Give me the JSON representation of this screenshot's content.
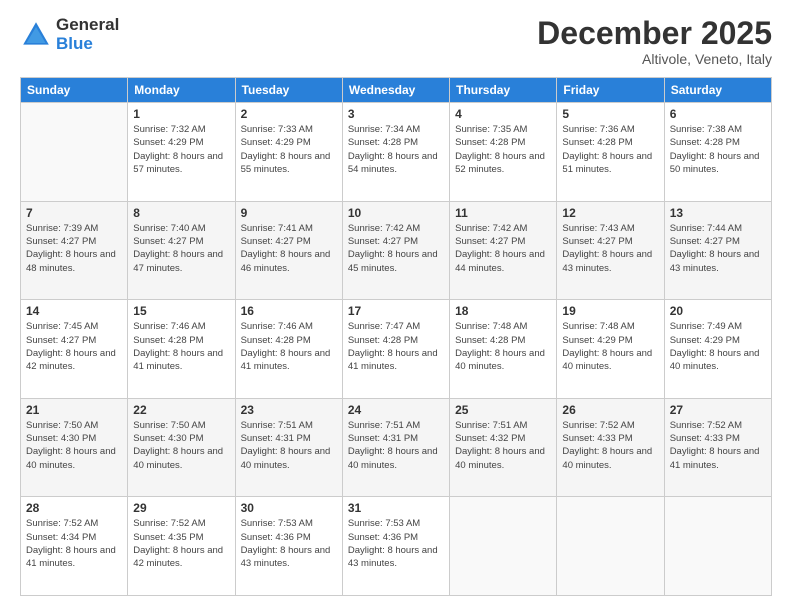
{
  "logo": {
    "general": "General",
    "blue": "Blue"
  },
  "header": {
    "month": "December 2025",
    "location": "Altivole, Veneto, Italy"
  },
  "days_of_week": [
    "Sunday",
    "Monday",
    "Tuesday",
    "Wednesday",
    "Thursday",
    "Friday",
    "Saturday"
  ],
  "weeks": [
    [
      {
        "day": "",
        "sunrise": "",
        "sunset": "",
        "daylight": "",
        "empty": true
      },
      {
        "day": "1",
        "sunrise": "Sunrise: 7:32 AM",
        "sunset": "Sunset: 4:29 PM",
        "daylight": "Daylight: 8 hours and 57 minutes."
      },
      {
        "day": "2",
        "sunrise": "Sunrise: 7:33 AM",
        "sunset": "Sunset: 4:29 PM",
        "daylight": "Daylight: 8 hours and 55 minutes."
      },
      {
        "day": "3",
        "sunrise": "Sunrise: 7:34 AM",
        "sunset": "Sunset: 4:28 PM",
        "daylight": "Daylight: 8 hours and 54 minutes."
      },
      {
        "day": "4",
        "sunrise": "Sunrise: 7:35 AM",
        "sunset": "Sunset: 4:28 PM",
        "daylight": "Daylight: 8 hours and 52 minutes."
      },
      {
        "day": "5",
        "sunrise": "Sunrise: 7:36 AM",
        "sunset": "Sunset: 4:28 PM",
        "daylight": "Daylight: 8 hours and 51 minutes."
      },
      {
        "day": "6",
        "sunrise": "Sunrise: 7:38 AM",
        "sunset": "Sunset: 4:28 PM",
        "daylight": "Daylight: 8 hours and 50 minutes."
      }
    ],
    [
      {
        "day": "7",
        "sunrise": "Sunrise: 7:39 AM",
        "sunset": "Sunset: 4:27 PM",
        "daylight": "Daylight: 8 hours and 48 minutes."
      },
      {
        "day": "8",
        "sunrise": "Sunrise: 7:40 AM",
        "sunset": "Sunset: 4:27 PM",
        "daylight": "Daylight: 8 hours and 47 minutes."
      },
      {
        "day": "9",
        "sunrise": "Sunrise: 7:41 AM",
        "sunset": "Sunset: 4:27 PM",
        "daylight": "Daylight: 8 hours and 46 minutes."
      },
      {
        "day": "10",
        "sunrise": "Sunrise: 7:42 AM",
        "sunset": "Sunset: 4:27 PM",
        "daylight": "Daylight: 8 hours and 45 minutes."
      },
      {
        "day": "11",
        "sunrise": "Sunrise: 7:42 AM",
        "sunset": "Sunset: 4:27 PM",
        "daylight": "Daylight: 8 hours and 44 minutes."
      },
      {
        "day": "12",
        "sunrise": "Sunrise: 7:43 AM",
        "sunset": "Sunset: 4:27 PM",
        "daylight": "Daylight: 8 hours and 43 minutes."
      },
      {
        "day": "13",
        "sunrise": "Sunrise: 7:44 AM",
        "sunset": "Sunset: 4:27 PM",
        "daylight": "Daylight: 8 hours and 43 minutes."
      }
    ],
    [
      {
        "day": "14",
        "sunrise": "Sunrise: 7:45 AM",
        "sunset": "Sunset: 4:27 PM",
        "daylight": "Daylight: 8 hours and 42 minutes."
      },
      {
        "day": "15",
        "sunrise": "Sunrise: 7:46 AM",
        "sunset": "Sunset: 4:28 PM",
        "daylight": "Daylight: 8 hours and 41 minutes."
      },
      {
        "day": "16",
        "sunrise": "Sunrise: 7:46 AM",
        "sunset": "Sunset: 4:28 PM",
        "daylight": "Daylight: 8 hours and 41 minutes."
      },
      {
        "day": "17",
        "sunrise": "Sunrise: 7:47 AM",
        "sunset": "Sunset: 4:28 PM",
        "daylight": "Daylight: 8 hours and 41 minutes."
      },
      {
        "day": "18",
        "sunrise": "Sunrise: 7:48 AM",
        "sunset": "Sunset: 4:28 PM",
        "daylight": "Daylight: 8 hours and 40 minutes."
      },
      {
        "day": "19",
        "sunrise": "Sunrise: 7:48 AM",
        "sunset": "Sunset: 4:29 PM",
        "daylight": "Daylight: 8 hours and 40 minutes."
      },
      {
        "day": "20",
        "sunrise": "Sunrise: 7:49 AM",
        "sunset": "Sunset: 4:29 PM",
        "daylight": "Daylight: 8 hours and 40 minutes."
      }
    ],
    [
      {
        "day": "21",
        "sunrise": "Sunrise: 7:50 AM",
        "sunset": "Sunset: 4:30 PM",
        "daylight": "Daylight: 8 hours and 40 minutes."
      },
      {
        "day": "22",
        "sunrise": "Sunrise: 7:50 AM",
        "sunset": "Sunset: 4:30 PM",
        "daylight": "Daylight: 8 hours and 40 minutes."
      },
      {
        "day": "23",
        "sunrise": "Sunrise: 7:51 AM",
        "sunset": "Sunset: 4:31 PM",
        "daylight": "Daylight: 8 hours and 40 minutes."
      },
      {
        "day": "24",
        "sunrise": "Sunrise: 7:51 AM",
        "sunset": "Sunset: 4:31 PM",
        "daylight": "Daylight: 8 hours and 40 minutes."
      },
      {
        "day": "25",
        "sunrise": "Sunrise: 7:51 AM",
        "sunset": "Sunset: 4:32 PM",
        "daylight": "Daylight: 8 hours and 40 minutes."
      },
      {
        "day": "26",
        "sunrise": "Sunrise: 7:52 AM",
        "sunset": "Sunset: 4:33 PM",
        "daylight": "Daylight: 8 hours and 40 minutes."
      },
      {
        "day": "27",
        "sunrise": "Sunrise: 7:52 AM",
        "sunset": "Sunset: 4:33 PM",
        "daylight": "Daylight: 8 hours and 41 minutes."
      }
    ],
    [
      {
        "day": "28",
        "sunrise": "Sunrise: 7:52 AM",
        "sunset": "Sunset: 4:34 PM",
        "daylight": "Daylight: 8 hours and 41 minutes."
      },
      {
        "day": "29",
        "sunrise": "Sunrise: 7:52 AM",
        "sunset": "Sunset: 4:35 PM",
        "daylight": "Daylight: 8 hours and 42 minutes."
      },
      {
        "day": "30",
        "sunrise": "Sunrise: 7:53 AM",
        "sunset": "Sunset: 4:36 PM",
        "daylight": "Daylight: 8 hours and 43 minutes."
      },
      {
        "day": "31",
        "sunrise": "Sunrise: 7:53 AM",
        "sunset": "Sunset: 4:36 PM",
        "daylight": "Daylight: 8 hours and 43 minutes."
      },
      {
        "day": "",
        "sunrise": "",
        "sunset": "",
        "daylight": "",
        "empty": true
      },
      {
        "day": "",
        "sunrise": "",
        "sunset": "",
        "daylight": "",
        "empty": true
      },
      {
        "day": "",
        "sunrise": "",
        "sunset": "",
        "daylight": "",
        "empty": true
      }
    ]
  ]
}
